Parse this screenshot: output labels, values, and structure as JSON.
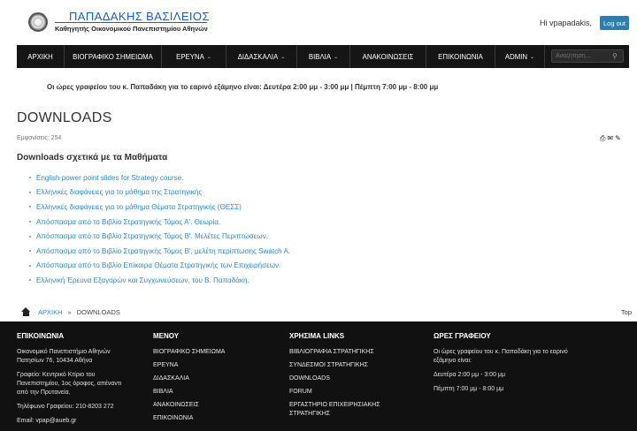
{
  "header": {
    "site_title": "ΠΑΠΑΔΑΚΗΣ ΒΑΣΙΛΕΙΟΣ",
    "site_subtitle": "Καθηγητής Οικονομικού Πανεπιστημίου Αθηνών",
    "greeting": "Hi vpapadakis,",
    "logout_label": "Log out"
  },
  "nav": {
    "items": [
      {
        "label": "ΑΡΧΙΚΗ",
        "caret": ""
      },
      {
        "label": "ΒΙΟΓΡΑΦΙΚΟ ΣΗΜΕΙΩΜΑ",
        "caret": ""
      },
      {
        "label": "ΕΡΕΥΝΑ",
        "caret": "⌄"
      },
      {
        "label": "ΔΙΔΑΣΚΑΛΙΑ",
        "caret": "⌄"
      },
      {
        "label": "ΒΙΒΛΙΑ",
        "caret": "⌄"
      },
      {
        "label": "ΑΝΑΚΟΙΝΩΣΕΙΣ",
        "caret": ""
      },
      {
        "label": "ΕΠΙΚΟΙΝΩΝΙΑ",
        "caret": ""
      },
      {
        "label": "ADMIN",
        "caret": "⌄"
      }
    ],
    "search_placeholder": "Αναζήτηση..."
  },
  "notice": "Οι ώρες γραφείου του κ. Παπαδάκη  για το εαρινό εξάμηνο είναι: Δευτέρα 2:00 μμ - 3:00 μμ | Πέμπτη 7:00 μμ - 8:00 μμ",
  "content": {
    "page_title": "DOWNLOADS",
    "hits": "Εμφανίσεις: 254",
    "section_heading": "Downloads σχετικά με τα Μαθήματα",
    "downloads": [
      "English power point slides for Strategy course.",
      "Ελληνικές διαφάνειες για το μάθημα της Στρατηγικής",
      "Ελληνικές διαφάνειες για το μάθημα Θέματα Στρατηγικής (ΘΕΣΣ)",
      "Απόσπασμα από το Βιβλίο Στρατηγικής Τόμος Α'. Θεωρία.",
      "Απόσπασμα από το Βιβλίο Στρατηγικής Τόμος Β'. Μελέτες Περιπτώσεων.",
      "Απόσπασμα από το Βιβλίο Στρατηγικής Τόμος Β', μελέτη περίπτωσης Swatch A.",
      "Απόσπασμα από το Βιβλίο Επίκαιρα Θέματα Στρατηγικής των Επιχειρήσεων.",
      "Ελληνική Έρευνα Εξαγορών και Συγχωνεύσεων, του Β. Παπαδάκη."
    ]
  },
  "breadcrumb": {
    "home": "ΑΡΧΙΚΗ",
    "separator": "»",
    "current": "DOWNLOADS",
    "top": "Top"
  },
  "footer": {
    "contact": {
      "heading": "ΕΠΙΚΟΙΝΩΝΙΑ",
      "address": "Οικονομικό Πανεπιστήμιο Αθηνών Πατησίων 76, 10434 Αθήνα",
      "office": "Γραφείο: Κεντρικό Κτίριο του Πανεπιστημίου, 1ος όροφος, απέναντι από την Πρυτανεία.",
      "phone": "Τηλέφωνο Γραφείου: 210-8203 272",
      "email": "Email: vpap@aueb.gr"
    },
    "menu": {
      "heading": "ΜΕΝΟΥ",
      "items": [
        "ΒΙΟΓΡΑΦΙΚΟ ΣΗΜΕΙΩΜΑ",
        "ΕΡΕΥΝΑ",
        "ΔΙΔΑΣΚΑΛΙΑ",
        "ΒΙΒΛΙΑ",
        "ΑΝΑΚΟΙΝΩΣΕΙΣ",
        "ΕΠΙΚΟΙΝΩΝΙΑ"
      ]
    },
    "links": {
      "heading": "ΧΡΗΣΙΜΑ LINKS",
      "items": [
        "ΒΙΒΛΙΟΓΡΑΦΙΑ ΣΤΡΑΤΗΓΙΚΗΣ",
        "ΣΥΝΔΕΣΜΟΙ ΣΤΡΑΤΗΓΙΚΗΣ",
        "DOWNLOADS",
        "FORUM",
        "ΕΡΓΑΣΤΗΡΙΟ ΕΠΙΧΕΙΡΗΣΙΑΚΗΣ ΣΤΡΑΤΗΓΙΚΗΣ"
      ]
    },
    "hours": {
      "heading": "ΩΡΕΣ ΓΡΑΦΕΙΟΥ",
      "intro": "Οι ώρες γραφείου του κ. Παπαδάκη  για το εαρινό εξάμηνο είναι:",
      "monday": "Δευτέρα 2:00 μμ - 3:00 μμ",
      "thursday": "Πέμπτη 7:00 μμ - 8:00 μμ"
    }
  }
}
